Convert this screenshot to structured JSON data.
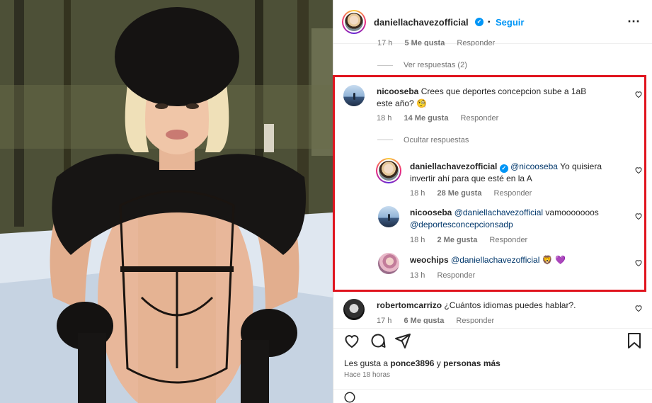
{
  "post": {
    "author": "daniellachavezofficial",
    "follow_label": "Seguir",
    "separator": "•",
    "more_icon": "⋯"
  },
  "comments": {
    "top_partial_meta": {
      "time": "17 h",
      "likes": "5 Me gusta",
      "reply": "Responder"
    },
    "view_replies": "Ver respuestas (2)",
    "main": {
      "user": "nicooseba",
      "text": "Crees que deportes concepcion sube a 1aB este año? 🧐",
      "time": "18 h",
      "likes": "14 Me gusta",
      "reply": "Responder"
    },
    "hide_replies": "Ocultar respuestas",
    "replies": [
      {
        "user": "daniellachavezofficial",
        "mention": "@nicooseba",
        "text": "Yo quisiera invertir ahí para que esté en la A",
        "time": "18 h",
        "likes": "28 Me gusta",
        "reply": "Responder"
      },
      {
        "user": "nicooseba",
        "mention": "@daniellachavezofficial",
        "text": "vamooooooos",
        "mention2": "@deportesconcepcionsadp",
        "time": "18 h",
        "likes": "2 Me gusta",
        "reply": "Responder"
      },
      {
        "user": "weochips",
        "mention": "@daniellachavezofficial",
        "text": "🦁 💜",
        "time": "13 h",
        "reply": "Responder"
      }
    ],
    "next": {
      "user": "robertomcarrizo",
      "text": "¿Cuántos idiomas puedes hablar?.",
      "time": "17 h",
      "likes": "6 Me gusta",
      "reply": "Responder"
    }
  },
  "footer": {
    "likes_prefix": "Les gusta a",
    "likes_user": "ponce3896",
    "likes_suffix": "y",
    "likes_others": "personas más",
    "time_ago": "Hace 18 horas"
  },
  "colors": {
    "highlight": "#e0141e",
    "link": "#0095f6",
    "mention": "#00376b"
  }
}
